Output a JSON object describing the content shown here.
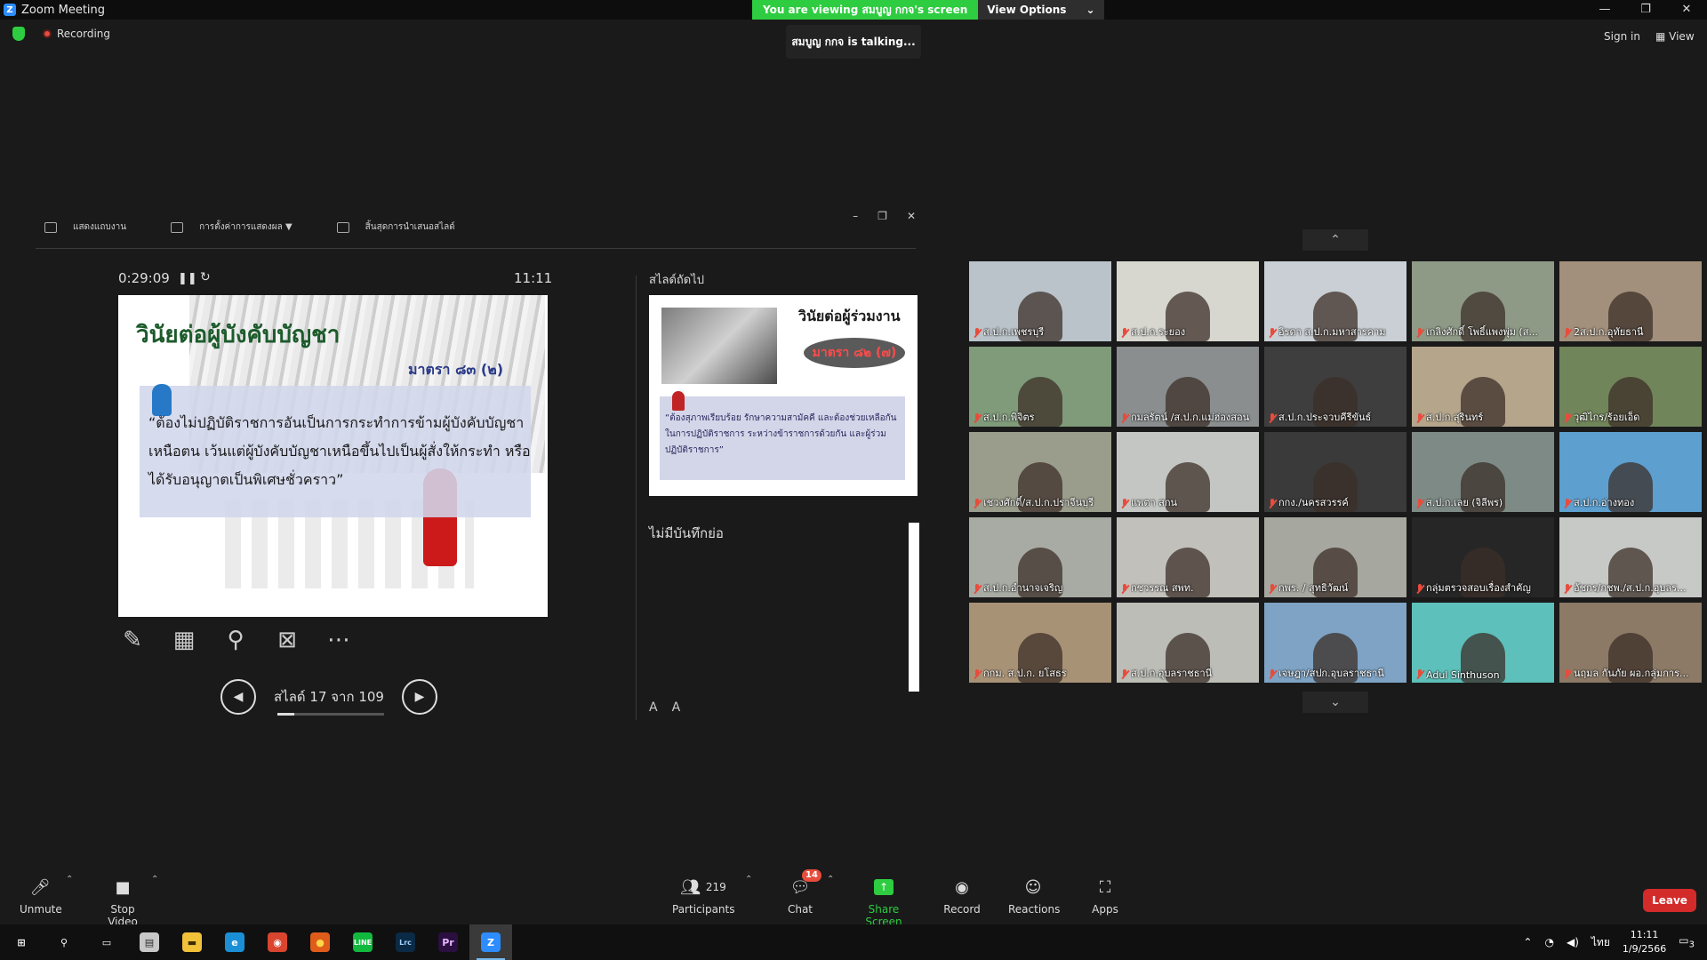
{
  "window": {
    "title": "Zoom Meeting",
    "logo": "Z",
    "controls": [
      "—",
      "❐",
      "✕"
    ]
  },
  "share_banner": {
    "message": "You are viewing สมบูญ กกจ's screen",
    "options": "View Options",
    "options_caret": "⌄"
  },
  "status": {
    "recording": "Recording",
    "talking": "สมบูญ กกจ is talking...",
    "sign_in": "Sign in",
    "view": "View"
  },
  "presenter": {
    "toolbar": [
      {
        "label": "แสดงแถบงาน",
        "icon": "taskbar-icon"
      },
      {
        "label": "การตั้งค่าการแสดงผล ▼",
        "icon": "display-settings-icon"
      },
      {
        "label": "สิ้นสุดการนำเสนอสไลด์",
        "icon": "end-show-icon"
      }
    ],
    "window_buttons": [
      "–",
      "❐",
      "✕"
    ],
    "timer": "0:29:09",
    "pause_icon": "❚❚",
    "reset_icon": "↻",
    "clock": "11:11",
    "current_slide": {
      "title": "วินัยต่อผู้บังคับบัญชา",
      "section": "มาตรา ๘๓ (๒)",
      "quote": "“ต้องไม่ปฏิบัติราชการอันเป็นการกระทำการข้ามผู้บังคับบัญชาเหนือตน เว้นแต่ผู้บังคับบัญชาเหนือขึ้นไปเป็นผู้สั่งให้กระทำ หรือได้รับอนุญาตเป็นพิเศษชั่วคราว”"
    },
    "annotation_tools": [
      {
        "name": "pen-icon",
        "glyph": "✎"
      },
      {
        "name": "all-slides-icon",
        "glyph": "▦"
      },
      {
        "name": "zoom-icon",
        "glyph": "⚲"
      },
      {
        "name": "black-screen-icon",
        "glyph": "⊠"
      },
      {
        "name": "more-options-icon",
        "glyph": "⋯"
      }
    ],
    "nav": {
      "prev": "◀",
      "next": "▶",
      "label": "สไลด์ 17 จาก 109"
    },
    "progress_fraction": 0.156,
    "next_slide_label": "สไลด์ถัดไป",
    "next_slide": {
      "title": "วินัยต่อผู้ร่วมงาน",
      "section": "มาตรา ๘๒ (๗)",
      "quote": "“ต้องสุภาพเรียบร้อย รักษาความสามัคคี และต้องช่วยเหลือกันในการปฏิบัติราชการ ระหว่างข้าราชการด้วยกัน และผู้ร่วมปฏิบัติราชการ”"
    },
    "notes": "ไม่มีบันทึกย่อ",
    "font_buttons": [
      "A",
      "A"
    ]
  },
  "gallery": {
    "up": "⌃",
    "down": "⌄",
    "participants": [
      {
        "name": "ส.ป.ก.เพชรบุรี",
        "bg": "#b9c3c9"
      },
      {
        "name": "ส.ป.ก.ระยอง",
        "bg": "#d7d7d0"
      },
      {
        "name": "อิรดา ส.ป.ก.มหาสารคาม",
        "bg": "#c9cfd4"
      },
      {
        "name": "เกลิงศักดิ์ โพธิ์แพงพุ่ม (ส...",
        "bg": "#8e9a86"
      },
      {
        "name": "2ส.ป.ก.อุทัยธานี",
        "bg": "#a2907c"
      },
      {
        "name": "ส.ป.ก.พิจิตร",
        "bg": "#7f9b7a"
      },
      {
        "name": "กมลรัตน์ /ส.ป.ก.แม่ฮ่องสอน",
        "bg": "#8a8e8f"
      },
      {
        "name": "ส.ป.ก.ประจวบคีรีขันธ์",
        "bg": "#3e3e3e"
      },
      {
        "name": "ส.ป.ก.สุรินทร์",
        "bg": "#b4a58b"
      },
      {
        "name": "วุฒิไกร/ร้อยเอ็ด",
        "bg": "#71855a"
      },
      {
        "name": "เชวงศักดิ์/ส.ป.ก.ปราจีนบุรี",
        "bg": "#9a9c8c"
      },
      {
        "name": "แพตา สกน",
        "bg": "#c4c6c3"
      },
      {
        "name": "กกง./นครสวรรค์",
        "bg": "#3a3a3a"
      },
      {
        "name": "ส.ป.ก.เลย (จิลีพร)",
        "bg": "#7e8a86"
      },
      {
        "name": "ส.ป.ก.อ่างทอง",
        "bg": "#5d9fcf"
      },
      {
        "name": "ส.ป.ก.อำนาจเจริญ",
        "bg": "#a8aba4"
      },
      {
        "name": "กชวรรณ สพท.",
        "bg": "#c2c0ba"
      },
      {
        "name": "กพร. / สุทธิวัฒน์",
        "bg": "#a6a89f"
      },
      {
        "name": "กลุ่มตรวจสอบเรื่องสำคัญ",
        "bg": "#262626"
      },
      {
        "name": "อัชกร/กชพ./ส.ป.ก.อุบลร...",
        "bg": "#c7c9c6"
      },
      {
        "name": "กกม. ส.ป.ก. ยโสธร",
        "bg": "#a89276"
      },
      {
        "name": "ส.ป.ก.อุบลราชธานี",
        "bg": "#bbbdb6"
      },
      {
        "name": "เจษฎา/สปก.อุบลราชธานี",
        "bg": "#7ea3c4"
      },
      {
        "name": "Adul Sinthuson",
        "bg": "#5dc0ba"
      },
      {
        "name": "นฤมล กันภัย ผอ.กลุ่มการ...",
        "bg": "#8c7a66"
      }
    ]
  },
  "toolbar": {
    "unmute": "Unmute",
    "stop_video": "Stop Video",
    "participants": "Participants",
    "participants_count": "219",
    "chat": "Chat",
    "chat_badge": "14",
    "share_screen": "Share Screen",
    "record": "Record",
    "reactions": "Reactions",
    "apps": "Apps",
    "leave": "Leave",
    "caret": "⌃"
  },
  "taskbar": {
    "apps": [
      {
        "name": "start-icon",
        "glyph": "⊞",
        "color": "#ffffff",
        "bg": "transparent"
      },
      {
        "name": "search-icon",
        "glyph": "⚲",
        "color": "#ffffff",
        "bg": "transparent"
      },
      {
        "name": "task-view-icon",
        "glyph": "▭",
        "color": "#ffffff",
        "bg": "transparent"
      },
      {
        "name": "file-explorer-icon",
        "glyph": "▤",
        "color": "#2b2b2b",
        "bg": "#c8c8c8"
      },
      {
        "name": "folder-icon",
        "glyph": "▬",
        "color": "#3a2b00",
        "bg": "#f2c13a"
      },
      {
        "name": "edge-icon",
        "glyph": "e",
        "color": "#ffffff",
        "bg": "#1a8fd6"
      },
      {
        "name": "chrome-icon",
        "glyph": "◉",
        "color": "#ffffff",
        "bg": "#d9452f"
      },
      {
        "name": "firefox-icon",
        "glyph": "●",
        "color": "#ffd54a",
        "bg": "#e05c1a"
      },
      {
        "name": "line-icon",
        "glyph": "LINE",
        "color": "#ffffff",
        "bg": "#12b93e"
      },
      {
        "name": "lightroom-icon",
        "glyph": "Lrc",
        "color": "#9fd0ff",
        "bg": "#0b2a45"
      },
      {
        "name": "premiere-icon",
        "glyph": "Pr",
        "color": "#e7b6ff",
        "bg": "#2a0f40"
      },
      {
        "name": "zoom-icon",
        "glyph": "Z",
        "color": "#ffffff",
        "bg": "#2d8cff"
      }
    ],
    "tray": {
      "caret": "⌃",
      "wifi": "◔",
      "volume": "◀)",
      "language": "ไทย",
      "time": "11:11",
      "date": "1/9/2566",
      "notifications": "3"
    }
  }
}
